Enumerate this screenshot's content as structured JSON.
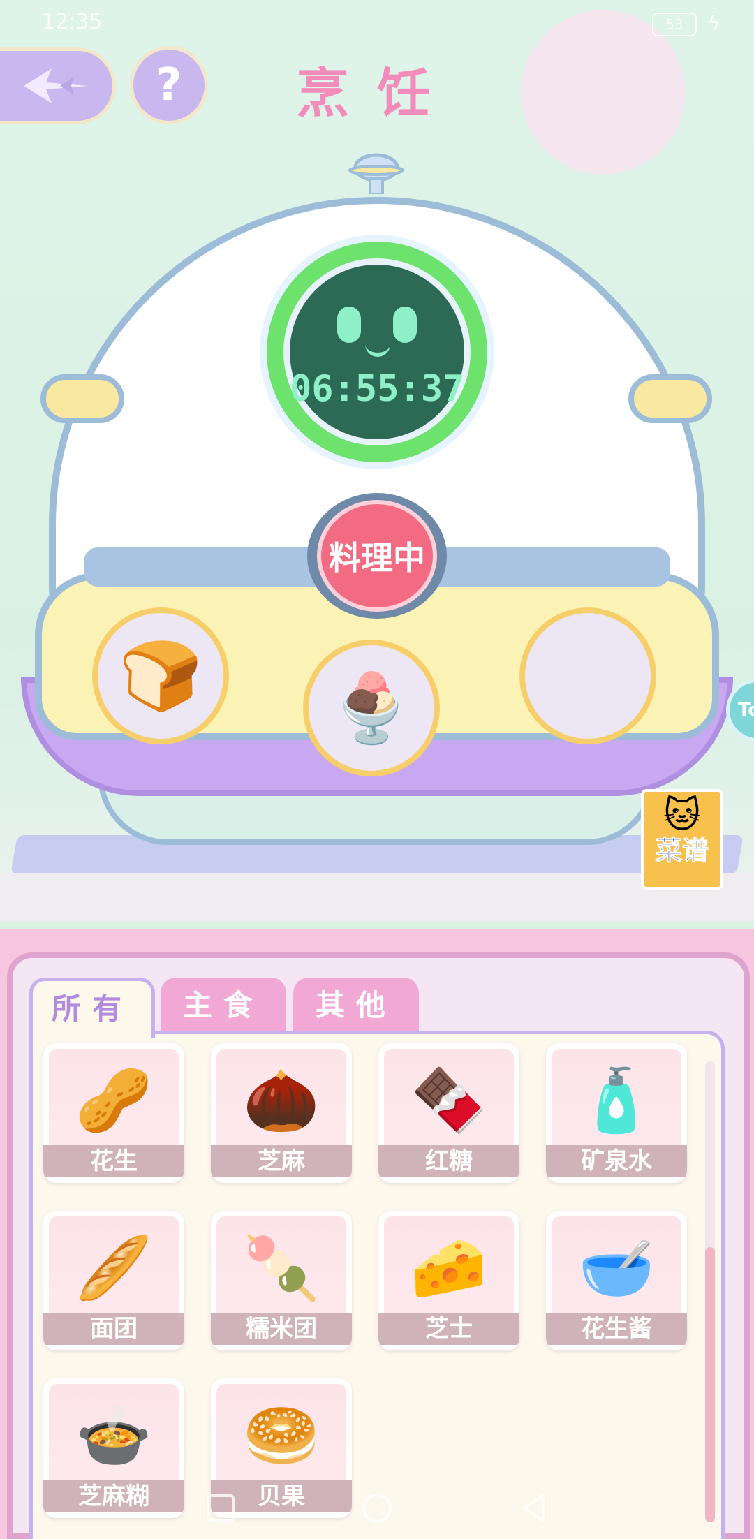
{
  "status_bar": {
    "time": "12:35",
    "battery": "53"
  },
  "header": {
    "title": "烹饪"
  },
  "timer": {
    "time": "06:55:37"
  },
  "cook_button": {
    "label": "料理中"
  },
  "recipe_book": {
    "label": "菜谱"
  },
  "side_tab": {
    "label": "To"
  },
  "tabs": [
    {
      "label": "所有",
      "active": true
    },
    {
      "label": "主食",
      "active": false
    },
    {
      "label": "其他",
      "active": false
    }
  ],
  "slots": [
    {
      "icon": "bread-icon"
    },
    {
      "icon": "cream-bowl-icon"
    },
    {
      "icon": "empty-slot"
    }
  ],
  "ingredients": [
    {
      "name": "花生",
      "icon": "peanut-bag-icon"
    },
    {
      "name": "芝麻",
      "icon": "sesame-sack-icon"
    },
    {
      "name": "红糖",
      "icon": "brown-sugar-icon"
    },
    {
      "name": "矿泉水",
      "icon": "water-bottle-icon"
    },
    {
      "name": "面团",
      "icon": "dough-tray-icon"
    },
    {
      "name": "糯米团",
      "icon": "rice-ball-bowl-icon"
    },
    {
      "name": "芝士",
      "icon": "cheese-icon"
    },
    {
      "name": "花生酱",
      "icon": "peanut-butter-bowl-icon"
    },
    {
      "name": "芝麻糊",
      "icon": "sesame-paste-bowl-icon"
    },
    {
      "name": "贝果",
      "icon": "bagel-icon"
    }
  ]
}
